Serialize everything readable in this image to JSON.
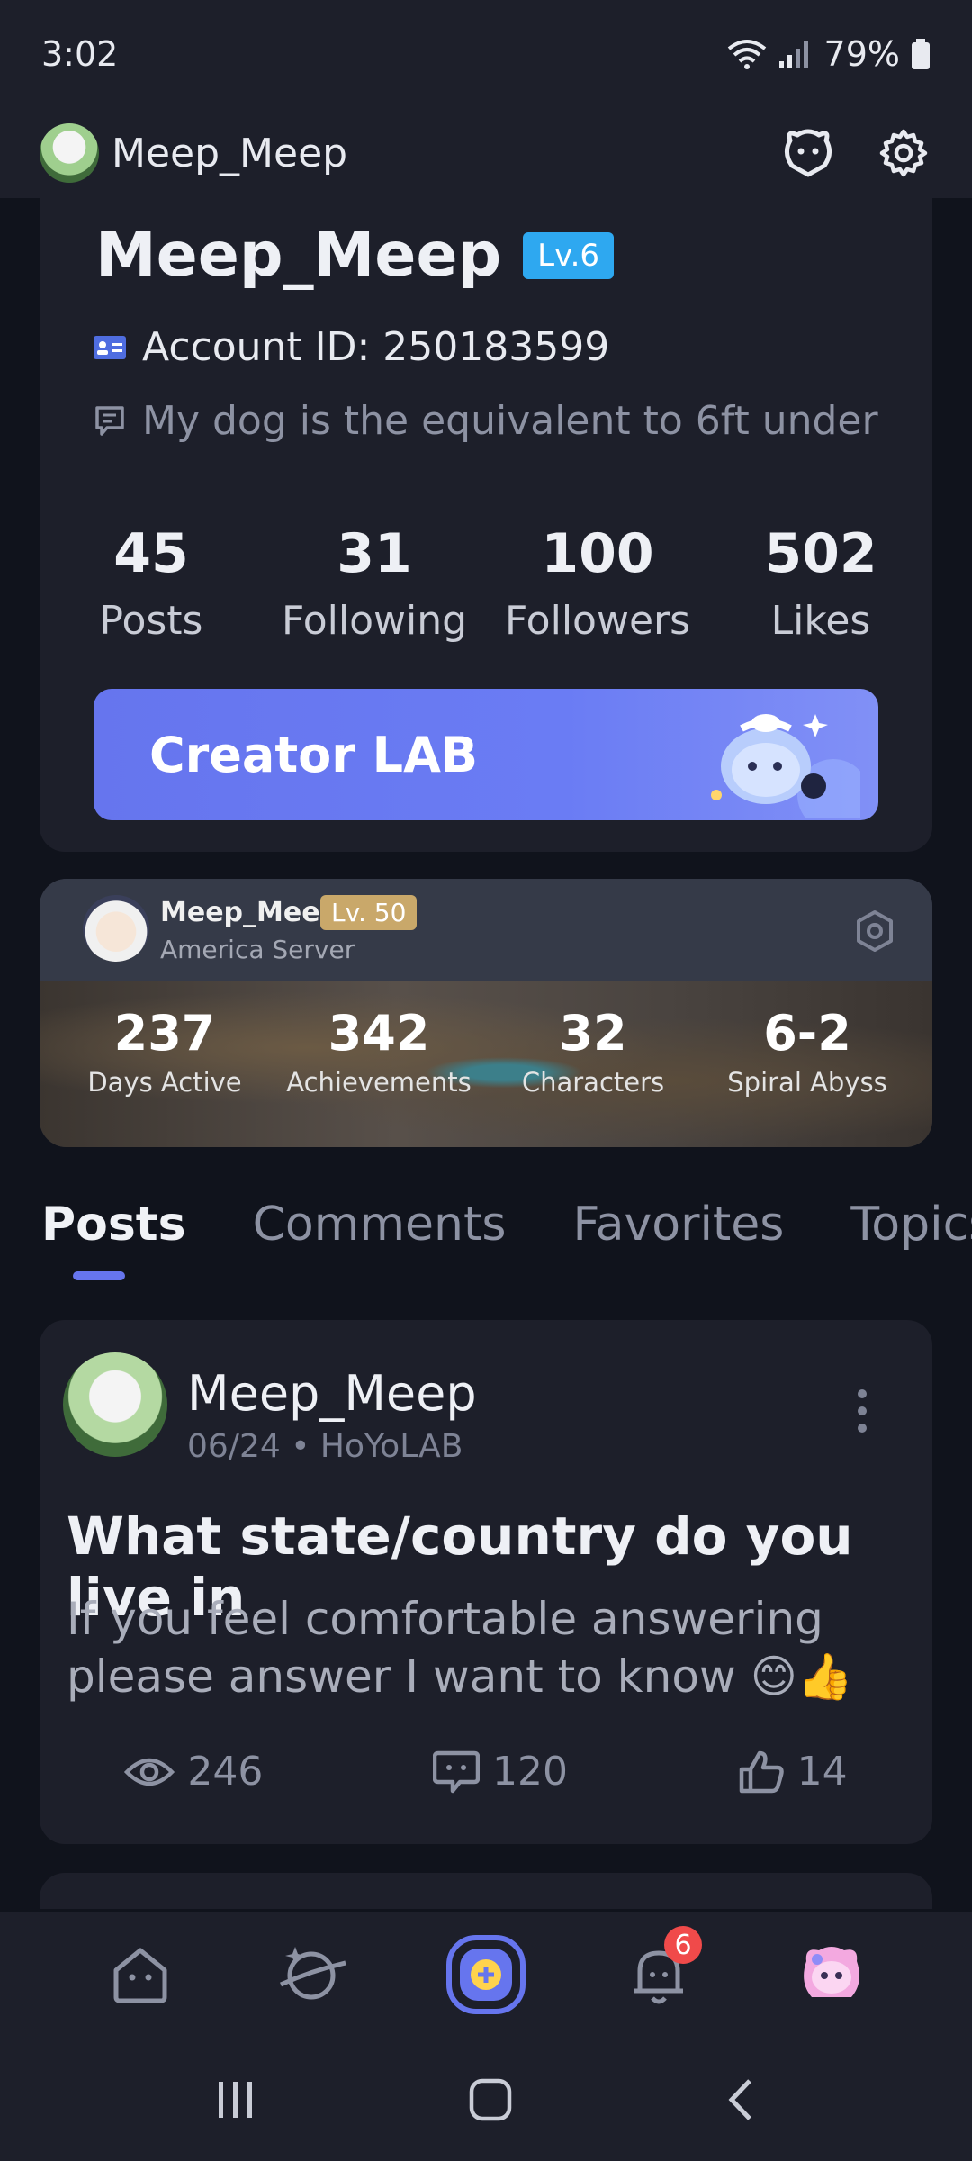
{
  "status_bar": {
    "time": "3:02",
    "battery": "79%"
  },
  "header": {
    "username": "Meep_Meep"
  },
  "profile": {
    "name": "Meep_Meep",
    "level": "Lv.6",
    "account_id": "Account ID: 250183599",
    "bio": "My dog is the equivalent to 6ft under",
    "stats": [
      {
        "value": "45",
        "label": "Posts"
      },
      {
        "value": "31",
        "label": "Following"
      },
      {
        "value": "100",
        "label": "Followers"
      },
      {
        "value": "502",
        "label": "Likes"
      }
    ],
    "creator_button": "Creator LAB"
  },
  "game_card": {
    "name": "Meep_Meep",
    "level": "Lv. 50",
    "server": "America Server",
    "stats": [
      {
        "value": "237",
        "label": "Days Active"
      },
      {
        "value": "342",
        "label": "Achievements"
      },
      {
        "value": "32",
        "label": "Characters"
      },
      {
        "value": "6-2",
        "label": "Spiral Abyss"
      }
    ]
  },
  "tabs": [
    "Posts",
    "Comments",
    "Favorites",
    "Topics"
  ],
  "post": {
    "author": "Meep_Meep",
    "meta": "06/24 • HoYoLAB",
    "title": "What state/country do you live in",
    "body": "If you feel comfortable answering please answer I want to know 😊👍",
    "views": "246",
    "comments": "120",
    "likes": "14"
  },
  "bottom_nav": {
    "notification_count": "6"
  },
  "colors": {
    "accent": "#6675ee",
    "background": "#10131c",
    "card": "#1d1f2a",
    "level_badge": "#2ea8f0",
    "game_level": "#c9a86a"
  }
}
